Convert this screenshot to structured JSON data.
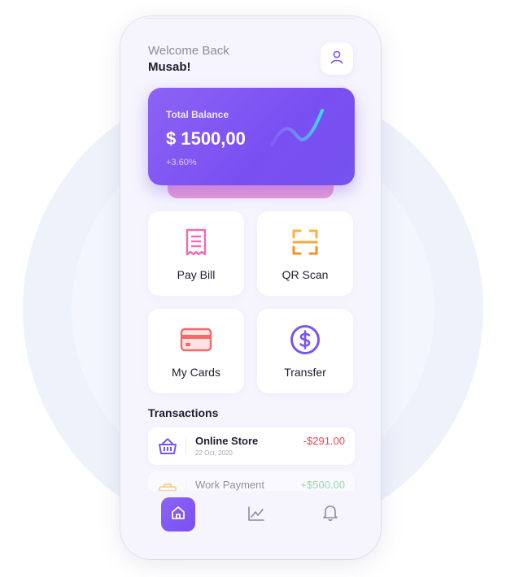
{
  "header": {
    "welcome": "Welcome Back",
    "username": "Musab!"
  },
  "balance": {
    "label": "Total Balance",
    "amount": "$ 1500,00",
    "change": "+3.60%"
  },
  "actions": [
    {
      "label": "Pay Bill",
      "icon": "receipt-icon"
    },
    {
      "label": "QR Scan",
      "icon": "qr-scan-icon"
    },
    {
      "label": "My Cards",
      "icon": "credit-card-icon"
    },
    {
      "label": "Transfer",
      "icon": "dollar-circle-icon"
    }
  ],
  "transactions": {
    "title": "Transactions",
    "items": [
      {
        "name": "Online Store",
        "date": "22 Oct, 2020",
        "amount": "-$291.00",
        "icon": "basket-icon"
      },
      {
        "name": "Work Payment",
        "date": "",
        "amount": "+$500.00",
        "icon": "briefcase-icon"
      }
    ]
  },
  "nav": {
    "items": [
      "home-icon",
      "chart-icon",
      "bell-icon"
    ]
  },
  "colors": {
    "accent": "#7b55f2",
    "negative": "#f0445a",
    "positive": "#44c767",
    "card_shadow": "#e79bd6"
  }
}
